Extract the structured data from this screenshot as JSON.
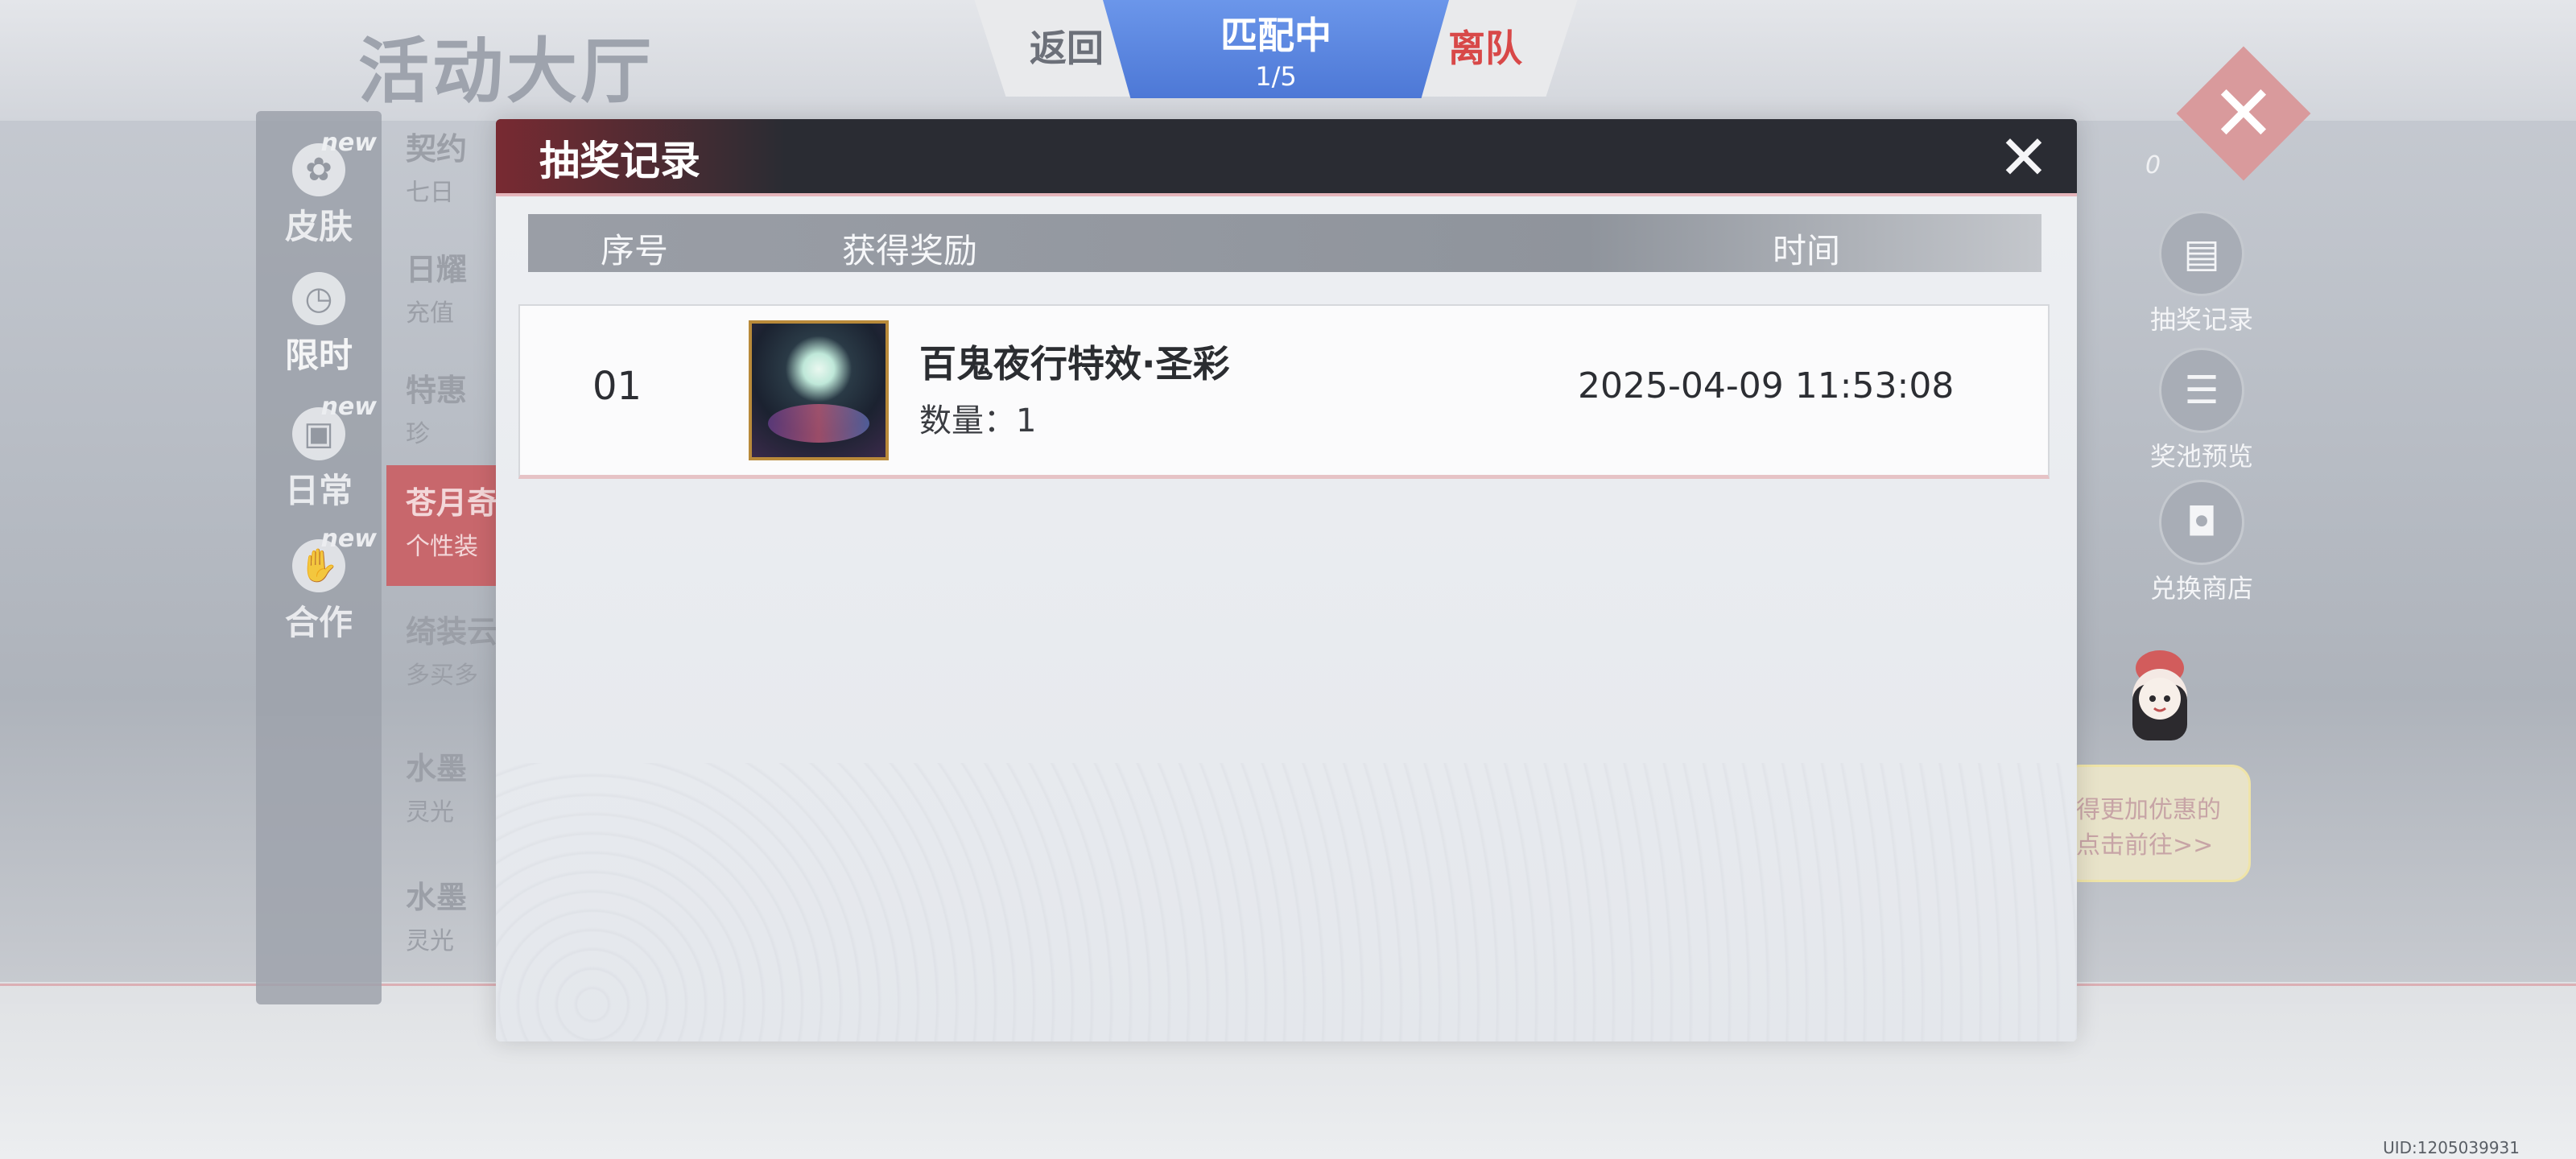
{
  "page": {
    "title": "活动大厅",
    "uid": "UID:1205039931"
  },
  "left_nav": [
    {
      "label": "皮肤",
      "icon": "bow-icon",
      "badge": "new"
    },
    {
      "label": "限时",
      "icon": "clock-icon",
      "badge": ""
    },
    {
      "label": "日常",
      "icon": "gift-icon",
      "badge": "new"
    },
    {
      "label": "合作",
      "icon": "handshake-icon",
      "badge": "new"
    }
  ],
  "activities": [
    {
      "title": "契约",
      "sub": "七日"
    },
    {
      "title": "日耀",
      "sub": "充值"
    },
    {
      "title": "特惠",
      "sub": "珍"
    },
    {
      "title": "苍月奇",
      "sub": "个性装"
    },
    {
      "title": "绮装云",
      "sub": "多买多"
    },
    {
      "title": "水墨",
      "sub": "灵光"
    },
    {
      "title": "水墨",
      "sub": "灵光"
    }
  ],
  "match_bar": {
    "back_label": "返回",
    "status": "匹配中",
    "count": "1/5",
    "leave_label": "离队"
  },
  "right_side": {
    "counter": "0",
    "buttons": [
      {
        "label": "抽奖记录",
        "icon": "calendar-icon"
      },
      {
        "label": "奖池预览",
        "icon": "document-icon"
      },
      {
        "label": "兑换商店",
        "icon": "shop-bag-icon"
      }
    ],
    "promo_line1": "得更加优惠的",
    "promo_line2": "点击前往>>"
  },
  "modal": {
    "title": "抽奖记录",
    "columns": {
      "index": "序号",
      "reward": "获得奖励",
      "time": "时间"
    },
    "records": [
      {
        "index": "01",
        "reward_name": "百鬼夜行特效·圣彩",
        "quantity": "数量：1",
        "time": "2025-04-09 11:53:08"
      }
    ]
  },
  "colors": {
    "match_blue": "#4d78d6",
    "leave_red": "#d84848",
    "modal_header": "#2a2c33"
  }
}
